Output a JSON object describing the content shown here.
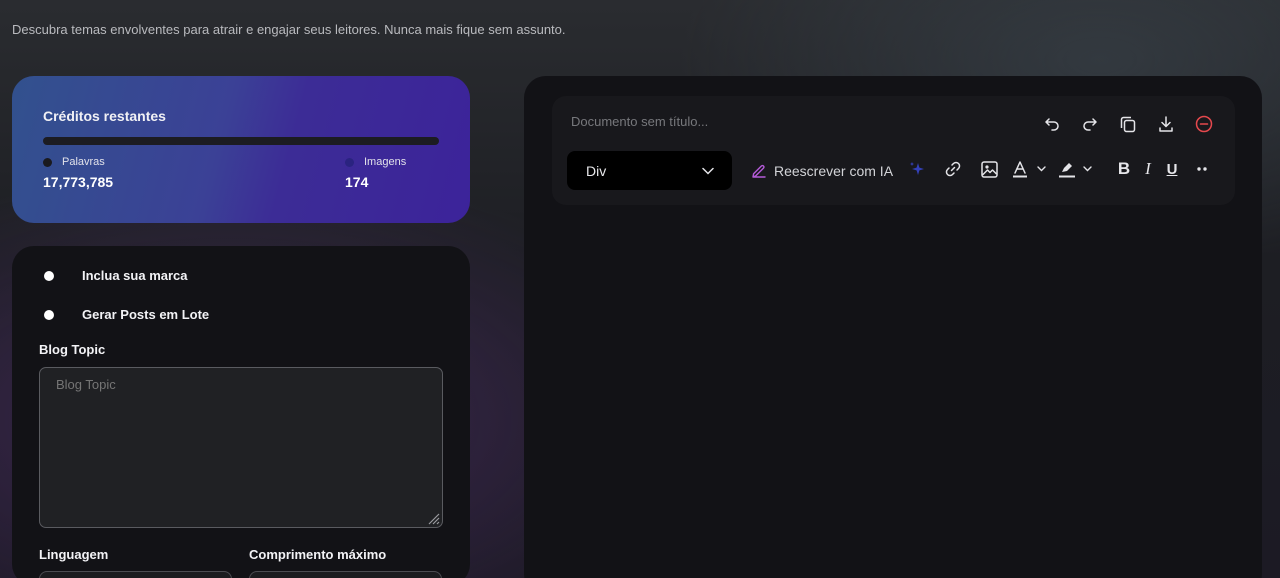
{
  "subtitle": "Descubra temas envolventes para atrair e engajar seus leitores. Nunca mais fique sem assunto.",
  "credits": {
    "title": "Créditos restantes",
    "words_label": "Palavras",
    "words_value": "17,773,785",
    "images_label": "Imagens",
    "images_value": "174"
  },
  "form": {
    "options": [
      "Inclua sua marca",
      "Gerar Posts em Lote"
    ],
    "topic_label": "Blog Topic",
    "topic_placeholder": "Blog Topic",
    "language_label": "Linguagem",
    "max_length_label": "Comprimento máximo"
  },
  "editor": {
    "doc_title_placeholder": "Documento sem título...",
    "block_type": "Div",
    "rewrite_label": "Reescrever com IA",
    "top_icons": [
      "undo-icon",
      "redo-icon",
      "copy-icon",
      "download-icon",
      "remove-circle-icon"
    ],
    "format_icons": [
      "sparkle-icon",
      "link-icon",
      "image-icon",
      "text-color-icon",
      "highlight-icon",
      "bold-icon",
      "italic-icon",
      "underline-icon",
      "more-icon"
    ]
  },
  "colors": {
    "accent_purple": "#b45ad8",
    "danger_red": "#e5484d",
    "sparkle_blue": "#3340b8"
  }
}
